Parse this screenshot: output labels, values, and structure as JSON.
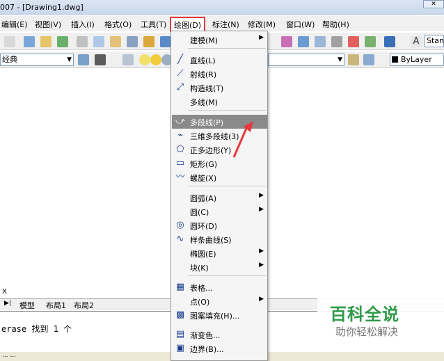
{
  "window": {
    "title": "007 - [Drawing1.dwg]",
    "close": "✕"
  },
  "menubar": {
    "items": [
      "编辑(E)",
      "视图(V)",
      "插入(I)",
      "格式(O)",
      "工具(T)",
      "绘图(D)",
      "标注(N)",
      "修改(M)",
      "窗口(W)",
      "帮助(H)"
    ]
  },
  "toolbar": {
    "style_combo": "经典",
    "layer_label": "ByLayer",
    "text_style": "Stan"
  },
  "draw_menu": {
    "items": [
      {
        "label": "建模(M)",
        "icon": "none",
        "submenu": true
      },
      {
        "label": "直线(L)",
        "icon": "line-icon"
      },
      {
        "label": "射线(R)",
        "icon": "ray-icon"
      },
      {
        "label": "构造线(T)",
        "icon": "xline-icon"
      },
      {
        "label": "多线(M)",
        "icon": "none"
      },
      {
        "label": "多段线(P)",
        "icon": "polyline-icon",
        "highlighted": true
      },
      {
        "label": "三维多段线(3)",
        "icon": "3dpoly-icon"
      },
      {
        "label": "正多边形(Y)",
        "icon": "polygon-icon"
      },
      {
        "label": "矩形(G)",
        "icon": "rectangle-icon"
      },
      {
        "label": "螺旋(X)",
        "icon": "helix-icon"
      },
      {
        "label": "圆弧(A)",
        "icon": "none",
        "submenu": true
      },
      {
        "label": "圆(C)",
        "icon": "none",
        "submenu": true
      },
      {
        "label": "圆环(D)",
        "icon": "donut-icon"
      },
      {
        "label": "样条曲线(S)",
        "icon": "spline-icon"
      },
      {
        "label": "椭圆(E)",
        "icon": "none",
        "submenu": true
      },
      {
        "label": "块(K)",
        "icon": "none",
        "submenu": true
      },
      {
        "label": "表格...",
        "icon": "table-icon"
      },
      {
        "label": "点(O)",
        "icon": "none",
        "submenu": true
      },
      {
        "label": "图案填充(H)...",
        "icon": "hatch-icon"
      },
      {
        "label": "渐变色...",
        "icon": "gradient-icon"
      },
      {
        "label": "边界(B)...",
        "icon": "boundary-icon"
      }
    ]
  },
  "layout_tabs": [
    "模型",
    "布局1",
    "布局2"
  ],
  "axis_label": "X",
  "command_line": "erase 找到 1 个",
  "status_text": "... ...",
  "watermark": {
    "title": "百科全说",
    "subtitle": "助你轻松解决"
  }
}
